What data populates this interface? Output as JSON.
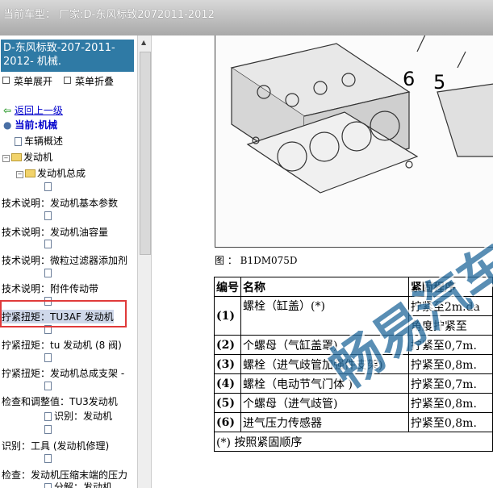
{
  "header": {
    "title": "当前车型： 厂家:D-东风标致2072011-2012"
  },
  "sidebar": {
    "title": "D-东风标致-207-2011-2012- 机械.",
    "expand_label": "菜单展开",
    "collapse_label": "菜单折叠",
    "back_label": "返回上一级",
    "current_label": "当前:机械",
    "tree": [
      "车辆概述",
      "发动机",
      "发动机总成",
      "技术说明：发动机基本参数",
      "技术说明：发动机油容量",
      "技术说明：微粒过滤器添加剂",
      "技术说明：附件传动带",
      "拧紧扭矩：TU3AF 发动机",
      "拧紧扭矩：tu 发动机 (8 阀)",
      "拧紧扭矩：发动机总成支架 -",
      "检查和调整值：TU3发动机",
      "识别：发动机",
      "识别：工具 (发动机修理)",
      "检查：发动机压缩末端的压力",
      "分解：发动机"
    ]
  },
  "figure": {
    "caption": "图 ： B1DM075D",
    "callouts": [
      "6",
      "5"
    ]
  },
  "spec_table": {
    "headers": [
      "编号",
      "名称",
      "紧固程序"
    ],
    "rows": [
      {
        "num": "(1)",
        "name": "螺栓（缸盖）(*)",
        "proc": [
          "拧紧至2m.da",
          "角度拧紧至"
        ]
      },
      {
        "num": "(2)",
        "name": "个螺母（气缸盖罩)",
        "proc": [
          "拧紧至0,7m."
        ]
      },
      {
        "num": "(3)",
        "name": "螺栓（进气歧管加强件支架)",
        "proc": [
          "拧紧至0,8m."
        ]
      },
      {
        "num": "(4)",
        "name": "螺栓（电动节气门体 )",
        "proc": [
          "拧紧至0,7m."
        ]
      },
      {
        "num": "(5)",
        "name": "个螺母（进气歧管)",
        "proc": [
          "拧紧至0,8m."
        ]
      },
      {
        "num": "(6)",
        "name": "进气压力传感器",
        "proc": [
          "拧紧至0,8m."
        ]
      }
    ],
    "footnote": "(*) 按照紧固顺序"
  },
  "watermark": {
    "text": "畅易汽车"
  },
  "colors": {
    "title_bg": "#2f7aa5",
    "link": "#0000cc",
    "highlight_box": "#e03a3a",
    "watermark": "#2b6f9f"
  }
}
